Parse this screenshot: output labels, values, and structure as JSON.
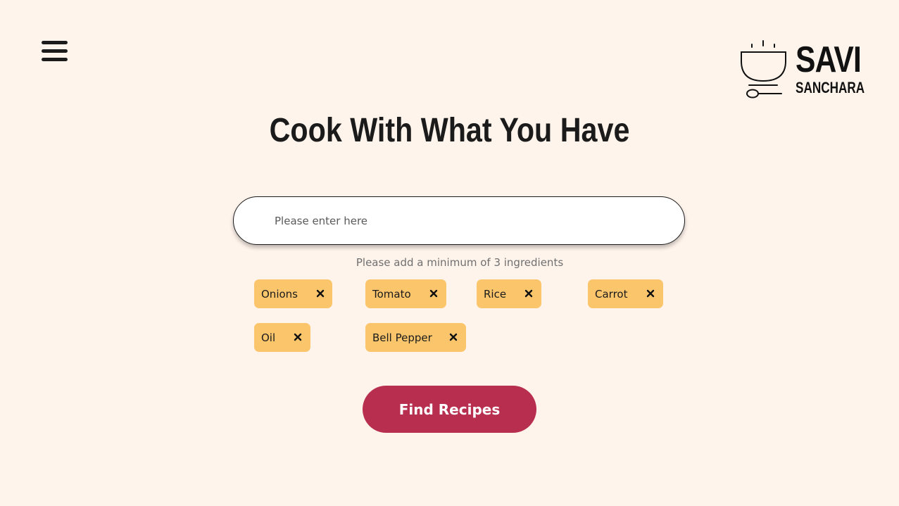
{
  "brand": {
    "name": "SAVI",
    "tagline": "SANCHARA"
  },
  "header": {
    "menu_icon": "hamburger-menu-icon",
    "logo_icon": "soup-bowl-icon"
  },
  "main": {
    "title": "Cook With What You Have",
    "search": {
      "placeholder": "Please enter here",
      "value": ""
    },
    "hint": "Please add a minimum of 3 ingredients",
    "ingredients": [
      {
        "label": "Onions"
      },
      {
        "label": "Tomato"
      },
      {
        "label": "Rice"
      },
      {
        "label": "Carrot"
      },
      {
        "label": "Oil"
      },
      {
        "label": "Bell Pepper"
      }
    ],
    "remove_icon": "close-icon",
    "submit_label": "Find Recipes"
  },
  "colors": {
    "background": "#fff4ec",
    "chip": "#fbc56c",
    "primary_button": "#b82e4e",
    "text": "#1b1b1b"
  }
}
